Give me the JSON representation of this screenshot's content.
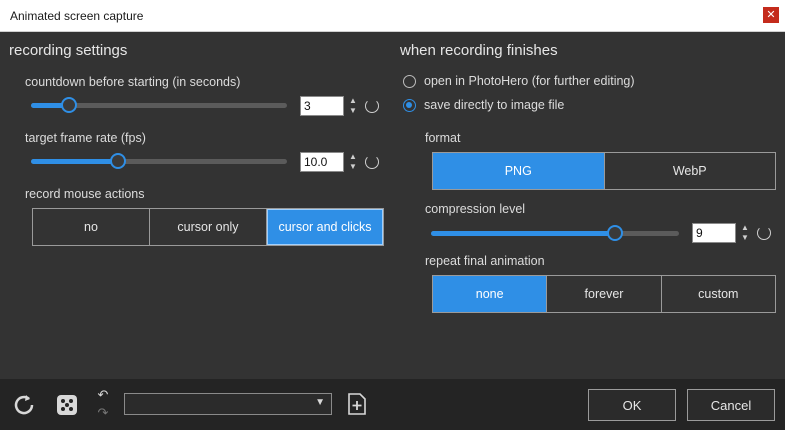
{
  "window": {
    "title": "Animated screen capture",
    "close_glyph": "✕"
  },
  "recording_settings": {
    "title": "recording settings",
    "countdown": {
      "label": "countdown before starting (in seconds)",
      "value": "3",
      "slider_fraction": 0.15
    },
    "frame_rate": {
      "label": "target frame rate (fps)",
      "value": "10.0",
      "slider_fraction": 0.34
    },
    "mouse": {
      "label": "record mouse actions",
      "options": [
        "no",
        "cursor only",
        "cursor and clicks"
      ],
      "selected": "cursor and clicks"
    }
  },
  "when_finished": {
    "title": "when recording finishes",
    "open_option": "open in PhotoHero (for further editing)",
    "save_option": "save directly to image file",
    "selected": "save directly to image file",
    "format": {
      "label": "format",
      "options": [
        "PNG",
        "WebP"
      ],
      "selected": "PNG"
    },
    "compression": {
      "label": "compression level",
      "value": "9",
      "slider_fraction": 0.74
    },
    "repeat": {
      "label": "repeat final animation",
      "options": [
        "none",
        "forever",
        "custom"
      ],
      "selected": "none"
    }
  },
  "footer": {
    "ok_label": "OK",
    "cancel_label": "Cancel",
    "preset_value": "",
    "icons": [
      "reset-all-icon",
      "dice-icon",
      "undo-icon",
      "redo-icon",
      "new-preset-icon"
    ]
  },
  "colors": {
    "accent": "#2f8fe6",
    "background": "#333333",
    "footer": "#242424"
  }
}
